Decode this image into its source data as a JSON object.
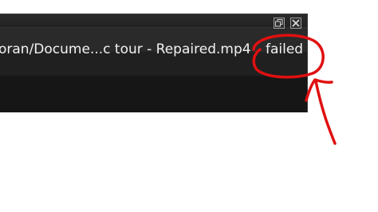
{
  "window": {
    "restore_icon": "restore-window-icon",
    "close_icon": "close-window-icon"
  },
  "download": {
    "file_path": "oran/Docume...c tour - Repaired.mp4",
    "status": "failed"
  },
  "annotation": {
    "color": "#e01010"
  }
}
